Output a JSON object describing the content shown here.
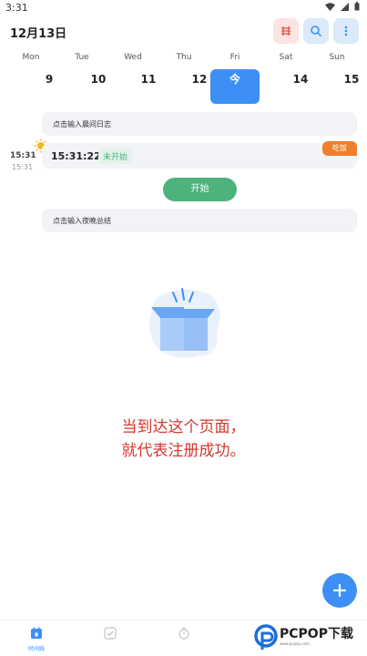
{
  "status_bar": {
    "time": "3:31"
  },
  "header": {
    "date": "12月13日",
    "filter_label": "",
    "search_label": "",
    "more_label": ""
  },
  "week": {
    "weekdays": [
      "Mon",
      "Tue",
      "Wed",
      "Thu",
      "Fri",
      "Sat",
      "Sun"
    ],
    "days": [
      "9",
      "10",
      "11",
      "12",
      "今",
      "14",
      "15"
    ],
    "today_index": 4
  },
  "timeline": {
    "morning_placeholder": "点击输入晨间日志",
    "time_main": "15:31",
    "time_sub": "15:31",
    "event": {
      "time": "15:31:22",
      "status": "未开始",
      "tag": "吃饭"
    },
    "start_button": "开始",
    "night_placeholder": "点击输入夜晚总结"
  },
  "message": {
    "line1": "当到达这个页面，",
    "line2": "就代表注册成功。"
  },
  "bottom_nav": {
    "items": [
      {
        "label": "时间线"
      }
    ]
  },
  "watermark": {
    "brand": "PCPOP下载",
    "sub": "www.pcpop.com"
  },
  "colors": {
    "accent": "#3d8ff5",
    "start_green": "#4db27c",
    "tag_orange": "#f07f2b",
    "message_red": "#d4372e"
  }
}
